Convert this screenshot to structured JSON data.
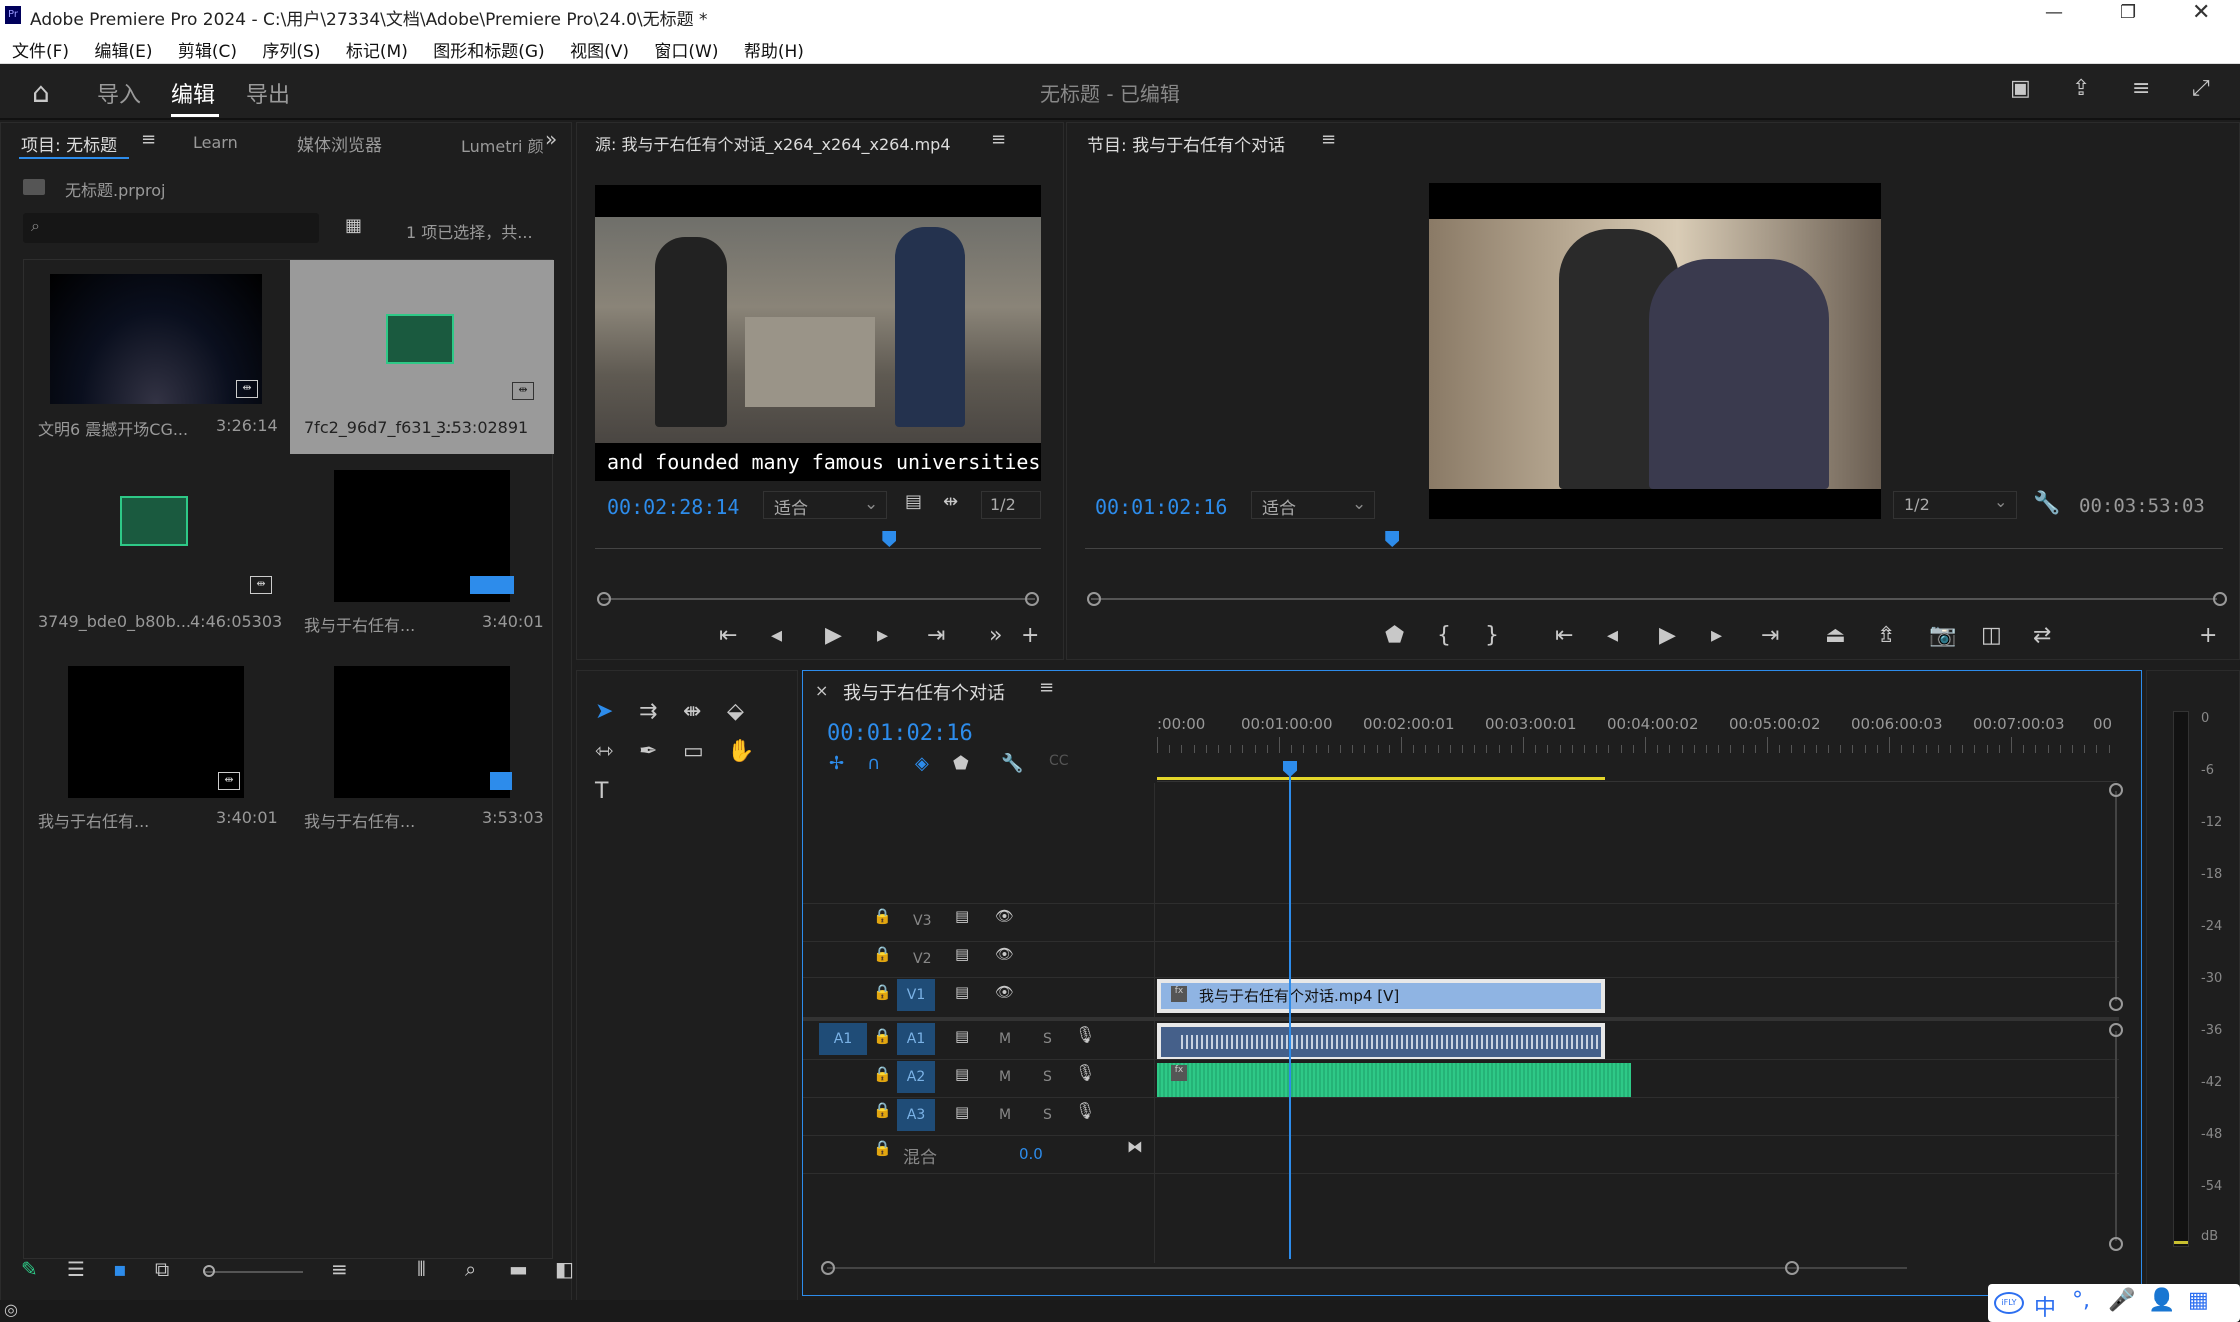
{
  "window": {
    "title": "Adobe Premiere Pro 2024 - C:\\用户\\27334\\文档\\Adobe\\Premiere Pro\\24.0\\无标题 *",
    "app_badge": "Pr"
  },
  "menu": [
    "文件(F)",
    "编辑(E)",
    "剪辑(C)",
    "序列(S)",
    "标记(M)",
    "图形和标题(G)",
    "视图(V)",
    "窗口(W)",
    "帮助(H)"
  ],
  "header": {
    "import": "导入",
    "edit": "编辑",
    "export": "导出",
    "doc_title": "无标题 - 已编辑"
  },
  "project": {
    "tabs": [
      "项目: 无标题",
      "Learn",
      "媒体浏览器",
      "Lumetri 颜"
    ],
    "file": "无标题.prproj",
    "search_placeholder": "",
    "selection_info": "1 项已选择，共...",
    "items": [
      {
        "name": "文明6 震撼开场CG...",
        "duration": "3:26:14"
      },
      {
        "name": "7fc2_96d7_f631_...",
        "duration": "3:53:02891"
      },
      {
        "name": "3749_bde0_b80b...",
        "duration": "4:46:05303"
      },
      {
        "name": "我与于右任有...",
        "duration": "3:40:01"
      },
      {
        "name": "我与于右任有...",
        "duration": "3:40:01"
      },
      {
        "name": "我与于右任有...",
        "duration": "3:53:03"
      }
    ]
  },
  "source": {
    "title": "源: 我与于右任有个对话_x264_x264_x264.mp4",
    "subtitle": "and founded many famous universities",
    "timecode": "00:02:28:14",
    "fit": "适合",
    "resolution": "1/2",
    "playhead_fraction": 0.66
  },
  "program": {
    "title": "节目: 我与于右任有个对话",
    "timecode": "00:01:02:16",
    "fit": "适合",
    "resolution": "1/2",
    "duration": "00:03:53:03",
    "playhead_fraction": 0.27
  },
  "timeline": {
    "sequence": "我与于右任有个对话",
    "timecode": "00:01:02:16",
    "ruler": [
      ":00:00",
      "00:01:00:00",
      "00:02:00:01",
      "00:03:00:01",
      "00:04:00:02",
      "00:05:00:02",
      "00:06:00:03",
      "00:07:00:03",
      "00"
    ],
    "video_tracks": [
      "V3",
      "V2",
      "V1"
    ],
    "audio_tracks": [
      "A1",
      "A2",
      "A3"
    ],
    "source_patch": "A1",
    "mix_label": "混合",
    "mix_value": "0.0",
    "clip_v1": "我与于右任有个对话.mp4 [V]",
    "track_btn_m": "M",
    "track_btn_s": "S"
  },
  "meter": {
    "scale": [
      "0",
      "-6",
      "-12",
      "-18",
      "-24",
      "-30",
      "-36",
      "-42",
      "-48",
      "-54",
      "dB"
    ]
  },
  "ime": {
    "lang": "中",
    "brand": "iFLY"
  },
  "colors": {
    "accent": "#2d8ceb",
    "clip_video": "#8fb4e3",
    "clip_audio": "#2ec987",
    "track_active": "#1f4c77"
  }
}
